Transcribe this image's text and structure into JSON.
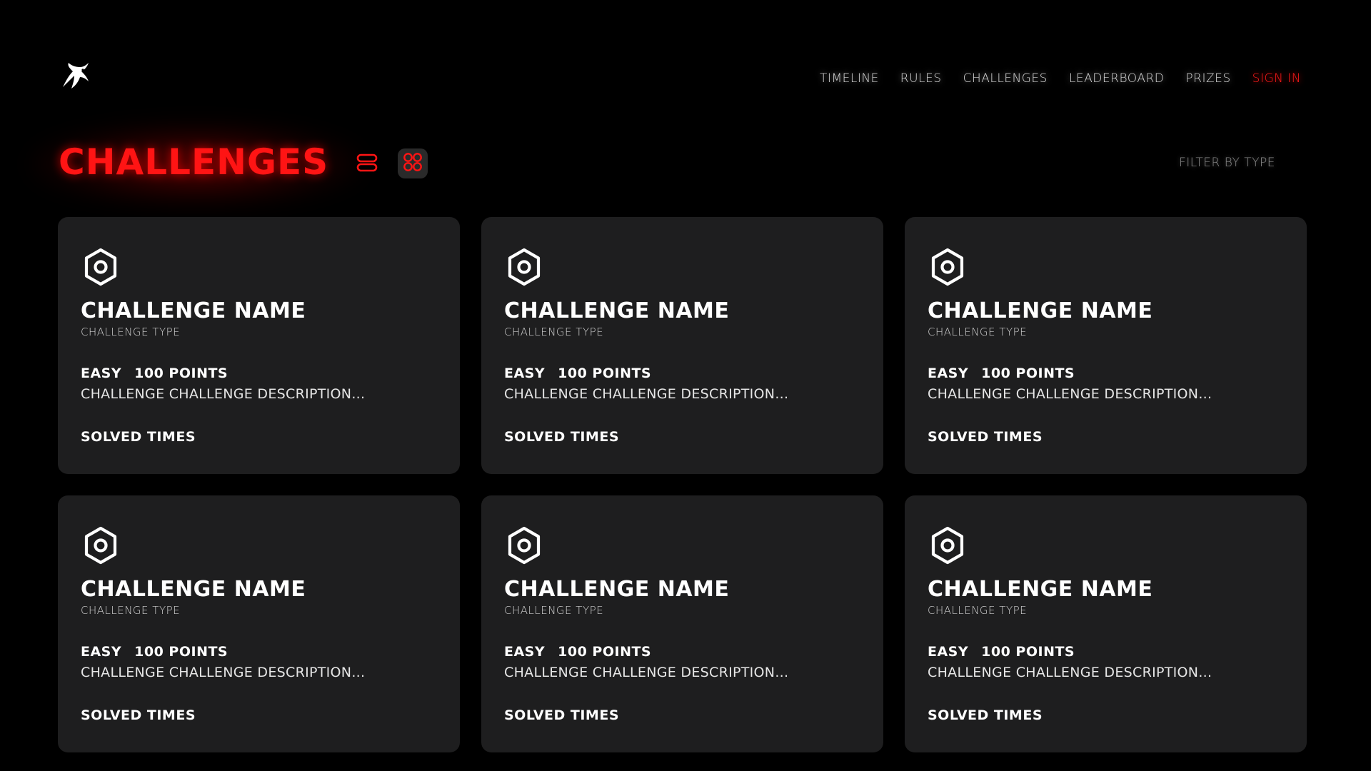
{
  "nav": {
    "items": [
      {
        "label": "TIMELINE"
      },
      {
        "label": "RULES"
      },
      {
        "label": "CHALLENGES"
      },
      {
        "label": "LEADERBOARD"
      },
      {
        "label": "PRIZES"
      },
      {
        "label": "SIGN IN"
      }
    ]
  },
  "page": {
    "title": "CHALLENGES",
    "filter_label": "FILTER BY TYPE"
  },
  "colors": {
    "accent": "#ff1414",
    "background": "#000000",
    "card": "#1e1e1f"
  },
  "icons": {
    "logo": "penguin-logo-icon",
    "list_view": "list-view-icon",
    "grid_view": "grid-view-icon",
    "card": "hexagon-nut-icon"
  },
  "cards": [
    {
      "name": "CHALLENGE NAME",
      "type": "CHALLENGE TYPE",
      "difficulty": "EASY",
      "points": "100 POINTS",
      "description": "CHALLENGE CHALLENGE DESCRIPTION...",
      "solved": "SOLVED TIMES"
    },
    {
      "name": "CHALLENGE NAME",
      "type": "CHALLENGE TYPE",
      "difficulty": "EASY",
      "points": "100 POINTS",
      "description": "CHALLENGE CHALLENGE DESCRIPTION...",
      "solved": "SOLVED TIMES"
    },
    {
      "name": "CHALLENGE NAME",
      "type": "CHALLENGE TYPE",
      "difficulty": "EASY",
      "points": "100 POINTS",
      "description": "CHALLENGE CHALLENGE DESCRIPTION...",
      "solved": "SOLVED TIMES"
    },
    {
      "name": "CHALLENGE NAME",
      "type": "CHALLENGE TYPE",
      "difficulty": "EASY",
      "points": "100 POINTS",
      "description": "CHALLENGE CHALLENGE DESCRIPTION...",
      "solved": "SOLVED TIMES"
    },
    {
      "name": "CHALLENGE NAME",
      "type": "CHALLENGE TYPE",
      "difficulty": "EASY",
      "points": "100 POINTS",
      "description": "CHALLENGE CHALLENGE DESCRIPTION...",
      "solved": "SOLVED TIMES"
    },
    {
      "name": "CHALLENGE NAME",
      "type": "CHALLENGE TYPE",
      "difficulty": "EASY",
      "points": "100 POINTS",
      "description": "CHALLENGE CHALLENGE DESCRIPTION...",
      "solved": "SOLVED TIMES"
    }
  ]
}
